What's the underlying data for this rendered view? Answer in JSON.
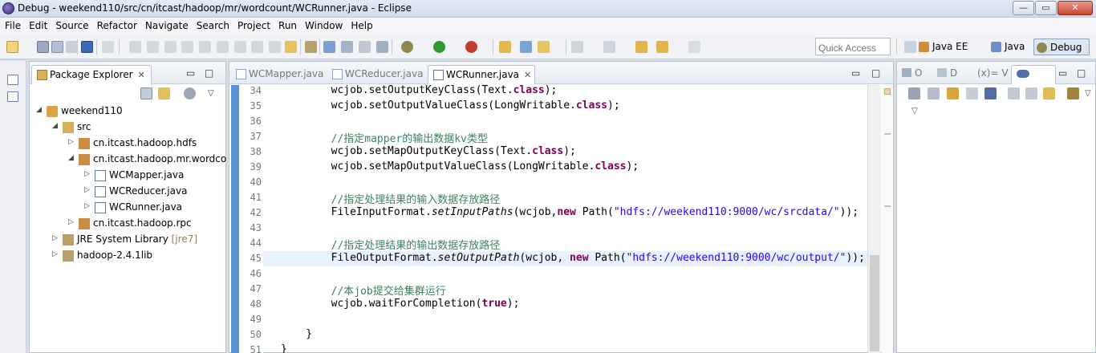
{
  "window": {
    "title": "Debug - weekend110/src/cn/itcast/hadoop/mr/wordcount/WCRunner.java - Eclipse",
    "minimize_glyph": "—",
    "maximize_glyph": "▭",
    "close_glyph": "✕"
  },
  "menu": [
    "File",
    "Edit",
    "Source",
    "Refactor",
    "Navigate",
    "Search",
    "Project",
    "Run",
    "Window",
    "Help"
  ],
  "toolbar": {
    "quick_access_placeholder": "Quick Access",
    "perspectives": [
      {
        "label": "Java EE",
        "active": false
      },
      {
        "label": "Java",
        "active": false
      },
      {
        "label": "Debug",
        "active": true
      }
    ]
  },
  "package_explorer": {
    "title": "Package Explorer",
    "close_glyph": "✕",
    "minimize_glyph": "▭",
    "maximize_glyph": "□",
    "tree": [
      {
        "label": "weekend110",
        "twisty": "◢",
        "indent": 0,
        "icon": "project-icon"
      },
      {
        "label": "src",
        "twisty": "◢",
        "indent": 1,
        "icon": "source-folder-icon"
      },
      {
        "label": "cn.itcast.hadoop.hdfs",
        "twisty": "▷",
        "indent": 2,
        "icon": "package-icon"
      },
      {
        "label": "cn.itcast.hadoop.mr.wordco",
        "twisty": "◢",
        "indent": 2,
        "icon": "package-icon"
      },
      {
        "label": "WCMapper.java",
        "twisty": "▷",
        "indent": 3,
        "icon": "java-file-icon"
      },
      {
        "label": "WCReducer.java",
        "twisty": "▷",
        "indent": 3,
        "icon": "java-file-icon"
      },
      {
        "label": "WCRunner.java",
        "twisty": "▷",
        "indent": 3,
        "icon": "java-file-icon"
      },
      {
        "label": "cn.itcast.hadoop.rpc",
        "twisty": "▷",
        "indent": 2,
        "icon": "package-icon"
      },
      {
        "label": "JRE System Library",
        "decoration": "[jre7]",
        "twisty": "▷",
        "indent": 1,
        "icon": "library-icon"
      },
      {
        "label": "hadoop-2.4.1lib",
        "twisty": "▷",
        "indent": 1,
        "icon": "library-icon"
      }
    ]
  },
  "editor": {
    "tabs": [
      {
        "label": "WCMapper.java",
        "active": false
      },
      {
        "label": "WCReducer.java",
        "active": false
      },
      {
        "label": "WCRunner.java",
        "active": true,
        "close": "✕"
      }
    ],
    "current_line": 45,
    "lines": [
      {
        "n": "34",
        "parts": [
          [
            "",
            "        wcjob.setOutputKeyClass(Text."
          ],
          [
            "kw",
            "class"
          ],
          [
            "",
            "); "
          ]
        ]
      },
      {
        "n": "35",
        "parts": [
          [
            "",
            "        wcjob.setOutputValueClass(LongWritable."
          ],
          [
            "kw",
            "class"
          ],
          [
            "",
            ");"
          ]
        ]
      },
      {
        "n": "36",
        "parts": []
      },
      {
        "n": "37",
        "parts": [
          [
            "cm",
            "        //指定mapper的输出数据kv类型"
          ]
        ]
      },
      {
        "n": "38",
        "parts": [
          [
            "",
            "        wcjob.setMapOutputKeyClass(Text."
          ],
          [
            "kw",
            "class"
          ],
          [
            "",
            ");"
          ]
        ]
      },
      {
        "n": "39",
        "parts": [
          [
            "",
            "        wcjob.setMapOutputValueClass(LongWritable."
          ],
          [
            "kw",
            "class"
          ],
          [
            "",
            ");"
          ]
        ]
      },
      {
        "n": "40",
        "parts": []
      },
      {
        "n": "41",
        "parts": [
          [
            "cm",
            "        //指定处理结果的输入数据存放路径"
          ]
        ]
      },
      {
        "n": "42",
        "parts": [
          [
            "",
            "        FileInputFormat."
          ],
          [
            "it",
            "setInputPaths"
          ],
          [
            "",
            "(wcjob,"
          ],
          [
            "kw",
            "new"
          ],
          [
            "",
            " Path("
          ],
          [
            "str",
            "\"hdfs://weekend110:9000/wc/srcdata/\""
          ],
          [
            "",
            "));"
          ]
        ]
      },
      {
        "n": "43",
        "parts": []
      },
      {
        "n": "44",
        "parts": [
          [
            "cm",
            "        //指定处理结果的输出数据存放路径"
          ]
        ]
      },
      {
        "n": "45",
        "parts": [
          [
            "",
            "        FileOutputFormat."
          ],
          [
            "it",
            "setOutputPath"
          ],
          [
            "",
            "(wcjob, "
          ],
          [
            "kw",
            "new"
          ],
          [
            "",
            " Path("
          ],
          [
            "str",
            "\"hdfs://weekend110:9000/wc/output/\""
          ],
          [
            "",
            "));"
          ]
        ]
      },
      {
        "n": "46",
        "parts": []
      },
      {
        "n": "47",
        "parts": [
          [
            "cm",
            "        //本job提交给集群运行"
          ]
        ]
      },
      {
        "n": "48",
        "parts": [
          [
            "",
            "        wcjob.waitForCompletion("
          ],
          [
            "kw",
            "true"
          ],
          [
            "",
            ");"
          ]
        ]
      },
      {
        "n": "49",
        "parts": []
      },
      {
        "n": "50",
        "parts": [
          [
            "",
            "    }"
          ]
        ]
      },
      {
        "n": "51",
        "parts": [
          [
            "",
            "}"
          ]
        ]
      }
    ]
  },
  "right_panel": {
    "tabs": [
      "O",
      "D",
      "(x)= V"
    ]
  },
  "colors": {
    "keyword": "#7f0055",
    "comment": "#3f7f5f",
    "string": "#2a00ff",
    "current_line": "#e8f2fe"
  }
}
